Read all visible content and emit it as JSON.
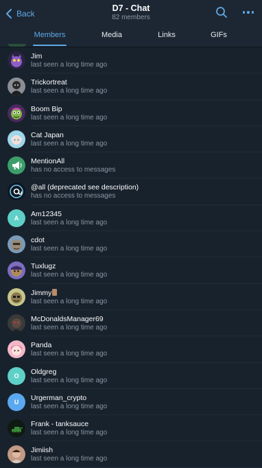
{
  "header": {
    "back_label": "Back",
    "title": "D7 - Chat",
    "subtitle": "82 members",
    "search_icon": "search-icon",
    "more_icon": "more-horizontal-icon"
  },
  "tabs": [
    {
      "label": "Members",
      "active": true
    },
    {
      "label": "Media",
      "active": false
    },
    {
      "label": "Links",
      "active": false
    },
    {
      "label": "GIFs",
      "active": false
    }
  ],
  "colors": {
    "accent": "#5ea8e6",
    "background": "#18222d",
    "header": "#1d2733",
    "secondary_text": "#8a97a5"
  },
  "members": [
    {
      "name": "Jim",
      "status": "last seen a long time ago",
      "avatar": "purple-creature"
    },
    {
      "name": "Trickortreat",
      "status": "last seen a long time ago",
      "avatar": "dark-figure"
    },
    {
      "name": "Boom Bip",
      "status": "last seen a long time ago",
      "avatar": "green-face"
    },
    {
      "name": "Cat Japan",
      "status": "last seen a long time ago",
      "avatar": "anime-girl"
    },
    {
      "name": "MentionAll",
      "status": "has no access to messages",
      "avatar": "megaphone-icon"
    },
    {
      "name": "@all (deprecated see description)",
      "status": "has no access to messages",
      "avatar": "at-sign-icon"
    },
    {
      "name": "Am12345",
      "status": "last seen a long time ago",
      "avatar": "initial",
      "initial": "A",
      "color": "#5fd0c7"
    },
    {
      "name": "cdot",
      "status": "last seen a long time ago",
      "avatar": "ape-blue"
    },
    {
      "name": "Tuxlugz",
      "status": "last seen a long time ago",
      "avatar": "ape-purple"
    },
    {
      "name": "Jimmy",
      "status": "last seen a long time ago",
      "avatar": "ape-olive",
      "emoji": "card"
    },
    {
      "name": "McDonaldsManager69",
      "status": "last seen a long time ago",
      "avatar": "dark-character"
    },
    {
      "name": "Panda",
      "status": "last seen a long time ago",
      "avatar": "pink-anime"
    },
    {
      "name": "Oldgreg",
      "status": "last seen a long time ago",
      "avatar": "initial",
      "initial": "O",
      "color": "#5fd0c7"
    },
    {
      "name": "Urgerman_crypto",
      "status": "last seen a long time ago",
      "avatar": "initial",
      "initial": "U",
      "color": "#5aa8f0"
    },
    {
      "name": "Frank - tanksauce",
      "status": "last seen a long time ago",
      "avatar": "tank"
    },
    {
      "name": "Jimiish",
      "status": "last seen a long time ago",
      "avatar": "photo-person"
    }
  ]
}
